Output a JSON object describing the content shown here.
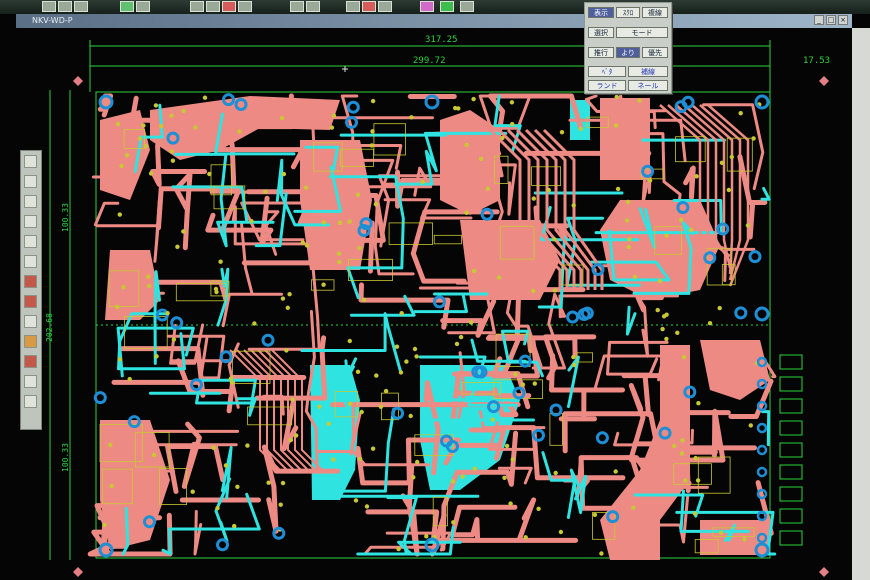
{
  "window": {
    "title": "NKV-WD-P"
  },
  "dimensions": {
    "top_total": "317.25",
    "top_inner": "299.72",
    "top_right": "17.53",
    "left_total": "202.68",
    "left_upper": "100.33",
    "left_lower": "100.33"
  },
  "palette": {
    "buttons": [
      "表示",
      "ｽｸﾛ",
      "複線",
      "選択",
      "モード",
      "推行",
      "より",
      "優先",
      "ﾍﾞﾀ",
      "補線",
      "ランド",
      "ネール"
    ]
  },
  "colors": {
    "background": "#050505",
    "copper_top": "#ee8a84",
    "copper_bottom": "#2fe3e0",
    "silk": "#c8c832",
    "outline": "#2bd33f",
    "pad": "#1d8fd6",
    "marker": "#e57f86"
  },
  "toolstrip": {
    "icons": [
      "pointer-icon",
      "select-icon",
      "move-icon",
      "route-icon",
      "via-icon",
      "pad-icon",
      "text-icon",
      "zoom-icon",
      "measure-icon",
      "layer-icon",
      "drc-icon",
      "undo-icon"
    ]
  }
}
